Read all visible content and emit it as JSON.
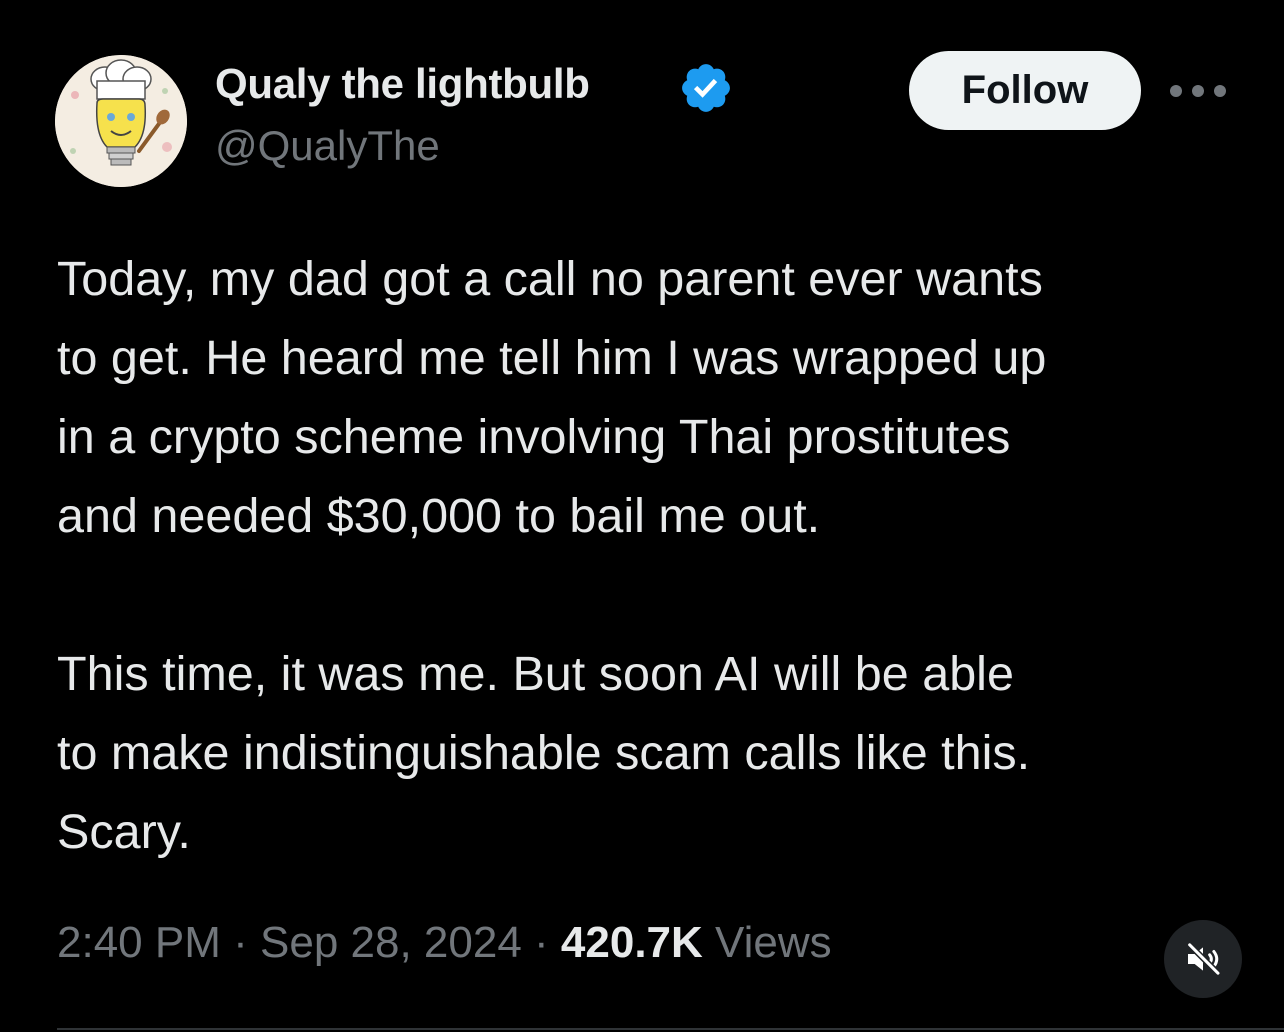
{
  "author": {
    "display_name": "Qualy the lightbulb",
    "handle": "@QualyThe",
    "verified": true,
    "avatar_icon": "chef-lightbulb-avatar"
  },
  "actions": {
    "follow_label": "Follow",
    "more_icon": "more-horizontal-icon"
  },
  "tweet": {
    "paragraphs": [
      [
        "Today, my dad got a call no parent ever wants",
        "to get. He heard me tell him I was wrapped up",
        "in a crypto scheme involving Thai prostitutes",
        "and needed $30,000 to bail me out."
      ],
      [
        "This time, it was me. But soon AI will be able",
        "to make indistinguishable scam calls like this.",
        "Scary."
      ]
    ]
  },
  "meta": {
    "time": "2:40 PM",
    "separator": "·",
    "date": "Sep 28, 2024",
    "views_count": "420.7K",
    "views_label": "Views"
  },
  "media_controls": {
    "mute_icon": "speaker-muted-icon"
  },
  "colors": {
    "background": "#000000",
    "primary_text": "#e7e9ea",
    "secondary_text": "#71767b",
    "verified_blue": "#1d9bf0",
    "follow_button_bg": "#eff3f4"
  }
}
